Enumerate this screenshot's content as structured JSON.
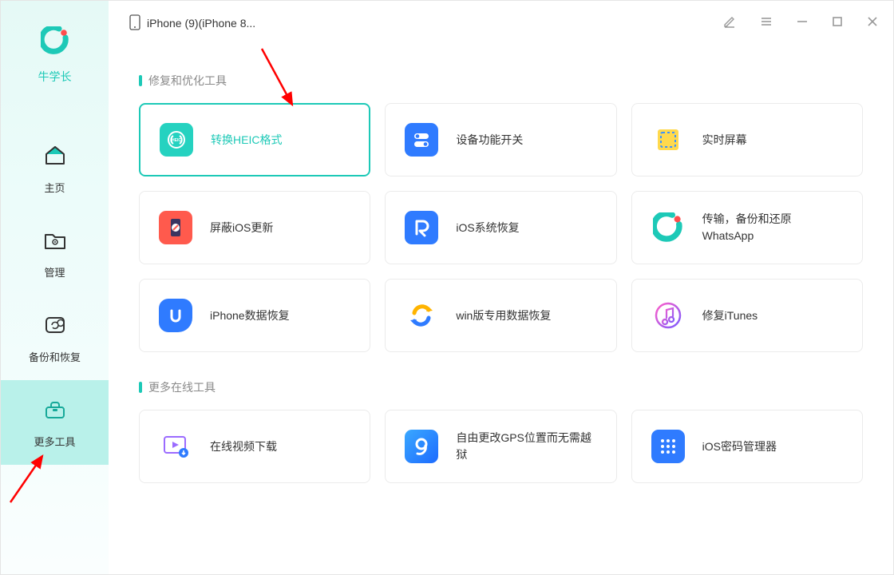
{
  "brand": {
    "name": "牛学长"
  },
  "sidebar": {
    "items": [
      {
        "label": "主页"
      },
      {
        "label": "管理"
      },
      {
        "label": "备份和恢复"
      },
      {
        "label": "更多工具"
      }
    ]
  },
  "header": {
    "device_text": "iPhone (9)(iPhone 8..."
  },
  "sections": [
    {
      "title": "修复和优化工具",
      "cards": [
        {
          "label": "转换HEIC格式"
        },
        {
          "label": "设备功能开关"
        },
        {
          "label": "实时屏幕"
        },
        {
          "label": "屏蔽iOS更新"
        },
        {
          "label": "iOS系统恢复"
        },
        {
          "label": "传输，备份和还原WhatsApp"
        },
        {
          "label": "iPhone数据恢复"
        },
        {
          "label": "win版专用数据恢复"
        },
        {
          "label": "修复iTunes"
        }
      ]
    },
    {
      "title": "更多在线工具",
      "cards": [
        {
          "label": "在线视频下载"
        },
        {
          "label": "自由更改GPS位置而无需越狱"
        },
        {
          "label": "iOS密码管理器"
        }
      ]
    }
  ]
}
